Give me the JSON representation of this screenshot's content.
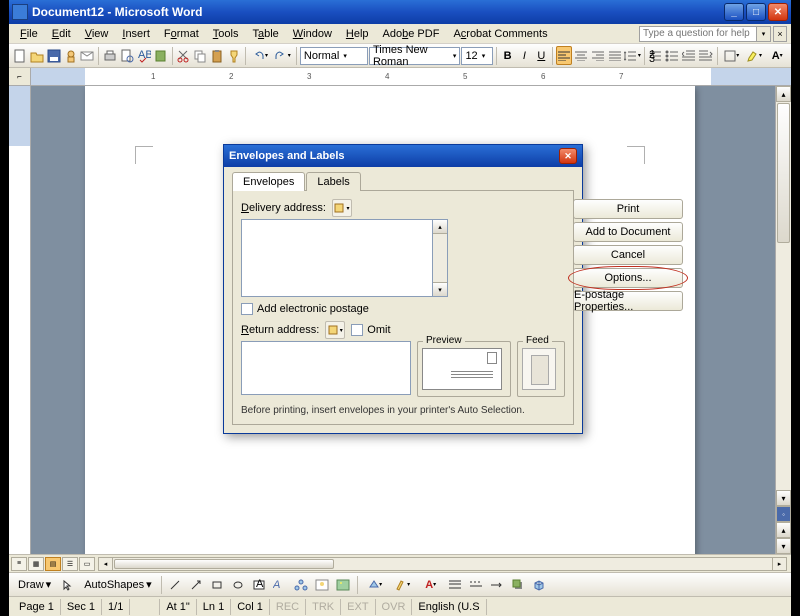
{
  "title": "Document12 - Microsoft Word",
  "menus": [
    "File",
    "Edit",
    "View",
    "Insert",
    "Format",
    "Tools",
    "Table",
    "Window",
    "Help",
    "Adobe PDF",
    "Acrobat Comments"
  ],
  "help_placeholder": "Type a question for help",
  "format_toolbar": {
    "style": "Normal",
    "font": "Times New Roman",
    "size": "12"
  },
  "ruler_ticks": [
    "1",
    "2",
    "3",
    "4",
    "5",
    "6",
    "7"
  ],
  "view_buttons": [
    "normal",
    "web",
    "print",
    "outline",
    "reading"
  ],
  "draw": {
    "label": "Draw",
    "autoshapes": "AutoShapes"
  },
  "status": {
    "page": "Page 1",
    "sec": "Sec 1",
    "pages": "1/1",
    "at": "At 1\"",
    "ln": "Ln 1",
    "col": "Col 1",
    "rec": "REC",
    "trk": "TRK",
    "ext": "EXT",
    "ovr": "OVR",
    "lang": "English (U.S"
  },
  "dialog": {
    "title": "Envelopes and Labels",
    "tabs": {
      "envelopes": "Envelopes",
      "labels": "Labels"
    },
    "delivery_label": "Delivery address:",
    "return_label": "Return address:",
    "add_epostage": "Add electronic postage",
    "omit": "Omit",
    "preview": "Preview",
    "feed": "Feed",
    "buttons": {
      "print": "Print",
      "add": "Add to Document",
      "cancel": "Cancel",
      "options": "Options...",
      "epostage": "E-postage Properties..."
    },
    "footnote": "Before printing, insert envelopes in your printer's Auto Selection."
  }
}
